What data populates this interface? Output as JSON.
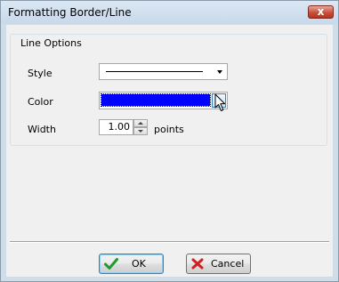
{
  "window": {
    "title": "Formatting Border/Line",
    "close_glyph": "x"
  },
  "group": {
    "title": "Line Options"
  },
  "fields": {
    "style_label": "Style",
    "style_value": "solid line",
    "color_label": "Color",
    "color_value": "#0000ff",
    "width_label": "Width",
    "width_value": "1.00",
    "width_unit": "points"
  },
  "buttons": {
    "ok_label": "OK",
    "cancel_label": "Cancel"
  },
  "icons": {
    "ok": "checkmark-icon",
    "cancel": "x-icon",
    "cursor": "mouse-pointer-icon"
  },
  "colors": {
    "accent": "#3c7fb1",
    "ok_icon": "#1e9a2e",
    "cancel_icon": "#d22020"
  }
}
